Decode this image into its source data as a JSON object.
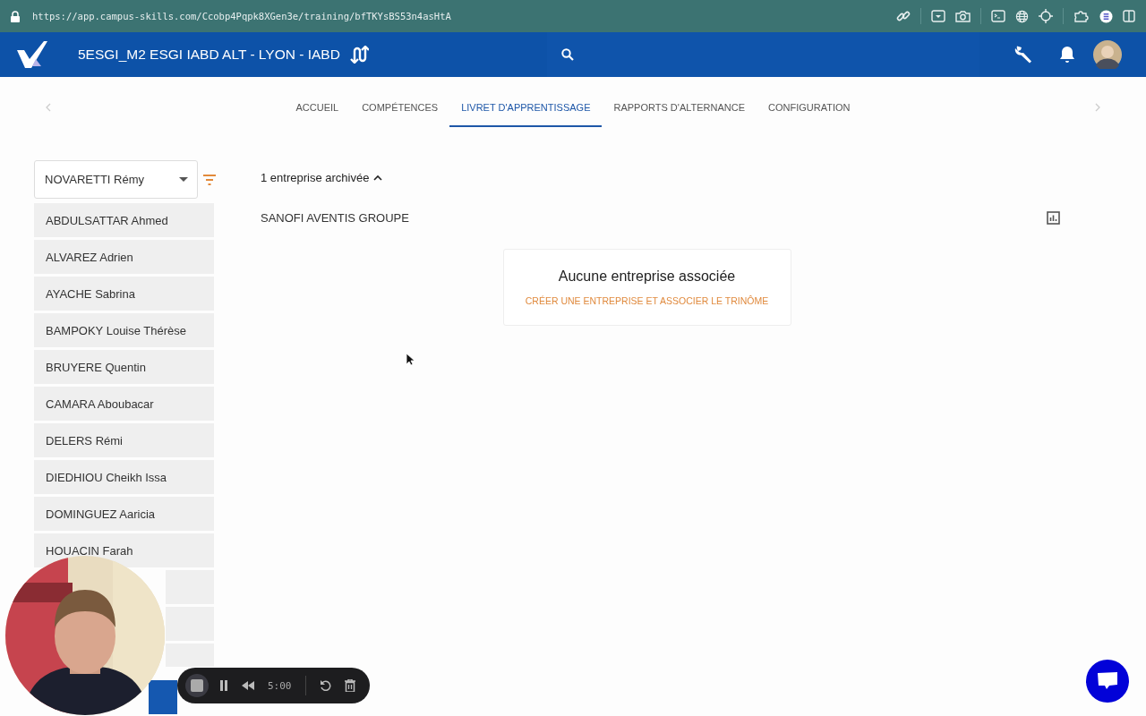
{
  "browser": {
    "url": "https://app.campus-skills.com/Ccobp4Pqpk8XGen3e/training/bfTKYsBS53n4asHtA"
  },
  "header": {
    "title": "5ESGI_M2 ESGI IABD ALT - LYON - IABD"
  },
  "tabs": [
    {
      "label": "ACCUEIL",
      "selected": false
    },
    {
      "label": "COMPÉTENCES",
      "selected": false
    },
    {
      "label": "LIVRET D'APPRENTISSAGE",
      "selected": true
    },
    {
      "label": "RAPPORTS D'ALTERNANCE",
      "selected": false
    },
    {
      "label": "CONFIGURATION",
      "selected": false
    }
  ],
  "sidebar": {
    "select": {
      "value": "NOVARETTI Rémy"
    },
    "items": [
      {
        "label": "ABDULSATTAR Ahmed",
        "selected": false
      },
      {
        "label": "ALVAREZ Adrien",
        "selected": false
      },
      {
        "label": "AYACHE Sabrina",
        "selected": false
      },
      {
        "label": "BAMPOKY Louise Thérèse",
        "selected": false
      },
      {
        "label": "BRUYERE Quentin",
        "selected": false
      },
      {
        "label": "CAMARA Aboubacar",
        "selected": false
      },
      {
        "label": "DELERS Rémi",
        "selected": false
      },
      {
        "label": "DIEDHIOU Cheikh Issa",
        "selected": false
      },
      {
        "label": "DOMINGUEZ Aaricia",
        "selected": false
      },
      {
        "label": "HOUACIN Farah",
        "selected": false
      },
      {
        "selected": false,
        "kind": "clipped"
      },
      {
        "selected": false,
        "kind": "clipped"
      },
      {
        "selected": false,
        "kind": "short"
      },
      {
        "selected": true,
        "kind": "sliver"
      }
    ]
  },
  "content": {
    "archived_toggle": {
      "label": "1 entreprise archivée",
      "expanded": true
    },
    "company": "SANOFI AVENTIS GROUPE",
    "empty_card": {
      "title": "Aucune entreprise associée",
      "action": "CRÉER UNE ENTREPRISE ET ASSOCIER LE TRINÔME"
    }
  },
  "recorder": {
    "time": "5:00"
  }
}
